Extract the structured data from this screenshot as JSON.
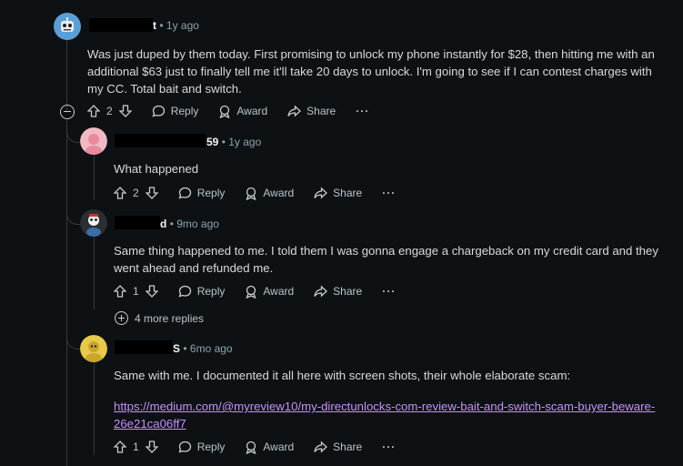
{
  "comments": [
    {
      "username_suffix": "t",
      "time": "1y ago",
      "body": "Was just duped by them today. First promising to unlock my phone instantly for $28, then hitting me with an additional $63 just to finally tell me it'll take 20 days to unlock. I'm going to see if I can contest charges with my CC. Total bait and switch.",
      "votes": "2"
    },
    {
      "username_suffix": "59",
      "time": "1y ago",
      "body": "What happened",
      "votes": "2"
    },
    {
      "username_suffix": "d",
      "time": "9mo ago",
      "body": "Same thing happened to me. I told them I was gonna engage a chargeback on my credit card and they went ahead and refunded me.",
      "votes": "1"
    },
    {
      "username_suffix": "S",
      "time": "6mo ago",
      "body": "Same with me. I documented it all here with screen shots, their whole elaborate scam:",
      "link": "https://medium.com/@myreview10/my-directunlocks-com-review-bait-and-switch-scam-buyer-beware-26e21ca06ff7",
      "votes": "1"
    }
  ],
  "actions": {
    "reply": "Reply",
    "award": "Award",
    "share": "Share",
    "more": "···"
  },
  "more_replies": "4 more replies",
  "separator": "•",
  "colors": {
    "background": "#0e1113",
    "text": "#d7dadc",
    "meta": "#8ba2ad",
    "link": "#c490ff",
    "redaction": "#000000"
  },
  "icons": [
    "robot-avatar-icon",
    "pink-avatar-icon",
    "dark-avatar-icon",
    "yellow-avatar-icon",
    "upvote-icon",
    "downvote-icon",
    "reply-icon",
    "award-icon",
    "share-icon",
    "collapse-icon",
    "expand-icon"
  ]
}
